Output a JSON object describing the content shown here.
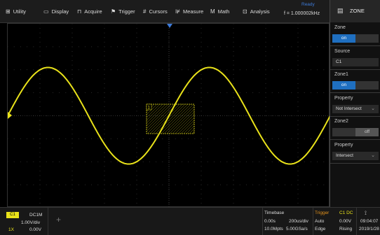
{
  "menu": {
    "items": [
      {
        "name": "utility",
        "label": "Utility",
        "icon": "utility-icon",
        "glyph": "⊞"
      },
      {
        "name": "display",
        "label": "Display",
        "icon": "display-icon",
        "glyph": "▭"
      },
      {
        "name": "acquire",
        "label": "Acquire",
        "icon": "acquire-icon",
        "glyph": "⊓"
      },
      {
        "name": "trigger",
        "label": "Trigger",
        "icon": "trigger-flag-icon",
        "glyph": "⚑"
      },
      {
        "name": "cursors",
        "label": "Cursors",
        "icon": "cursors-icon",
        "glyph": "#"
      },
      {
        "name": "measure",
        "label": "Measure",
        "icon": "measure-icon",
        "glyph": "⊯"
      },
      {
        "name": "math",
        "label": "Math",
        "icon": "math-icon",
        "glyph": "M"
      },
      {
        "name": "analysis",
        "label": "Analysis",
        "icon": "analysis-icon",
        "glyph": "⊡"
      }
    ],
    "status": "Ready",
    "frequency": "f = 1.000002kHz"
  },
  "zone_panel": {
    "title": "ZONE",
    "zone_label": "Zone",
    "zone_state": "on",
    "source_label": "Source",
    "source_value": "C1",
    "zone1_label": "Zone1",
    "zone1_state": "on",
    "property1_label": "Property",
    "property1_value": "Not Intersect",
    "zone2_label": "Zone2",
    "zone2_state": "off",
    "property2_label": "Property",
    "property2_value": "Intersect"
  },
  "waveform": {
    "zone_box_label": "1",
    "trace_color": "#e9e21a",
    "zone_color": "#e9e21a",
    "trigger_marker_color": "#3d7bd9"
  },
  "bottom": {
    "channel_badge": "C1",
    "coupling": "DC1M",
    "volts_div": "1.00V/div",
    "probe": "1X",
    "offset": "0.00V",
    "timebase_label": "Timebase",
    "delay": "0.00s",
    "time_div": "200us/div",
    "mpts": "10.0Mpts",
    "sample_rate": "5.00GSa/s",
    "trigger_label": "Trigger",
    "trigger_source": "C1 DC",
    "trigger_mode": "Auto",
    "trigger_level": "0.00V",
    "trigger_type": "Edge",
    "trigger_slope": "Rising",
    "time": "09:04:07",
    "date": "2019/1/28"
  }
}
